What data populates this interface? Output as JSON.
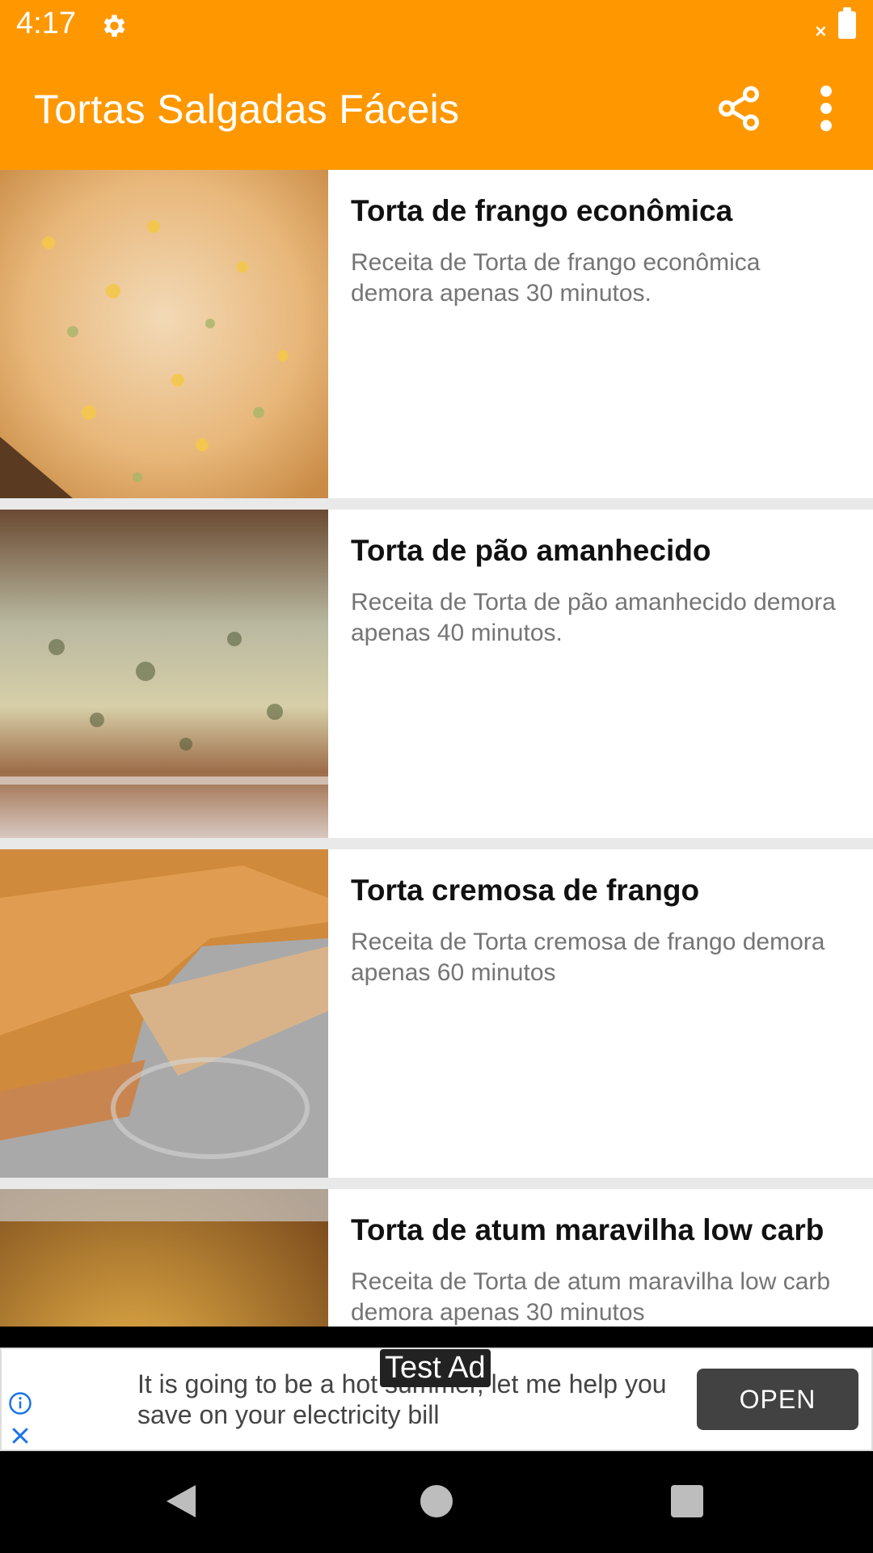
{
  "status_bar": {
    "time": "4:17",
    "icons": [
      "gear-icon",
      "x-small-icon",
      "battery-icon"
    ]
  },
  "app_bar": {
    "title": "Tortas Salgadas Fáceis",
    "actions": [
      "share-icon",
      "more-vert-icon"
    ]
  },
  "recipes": [
    {
      "title": "Torta de frango econômica",
      "description": "Receita de Torta de frango econômica demora apenas 30 minutos."
    },
    {
      "title": "Torta de pão amanhecido",
      "description": "Receita de Torta de pão amanhecido demora apenas 40 minutos."
    },
    {
      "title": "Torta cremosa de frango",
      "description": "Receita de Torta cremosa de frango demora apenas 60 minutos"
    },
    {
      "title": "Torta de atum maravilha low carb",
      "description": "Receita de Torta de atum maravilha low carb demora apenas 30 minutos"
    }
  ],
  "ad": {
    "label": "Test Ad",
    "text": "It is going to be a hot summer, let me help you save on your electricity bill",
    "button": "OPEN"
  },
  "colors": {
    "accent": "#ff9800",
    "divider": "#e9e9e9",
    "description": "#757575"
  }
}
